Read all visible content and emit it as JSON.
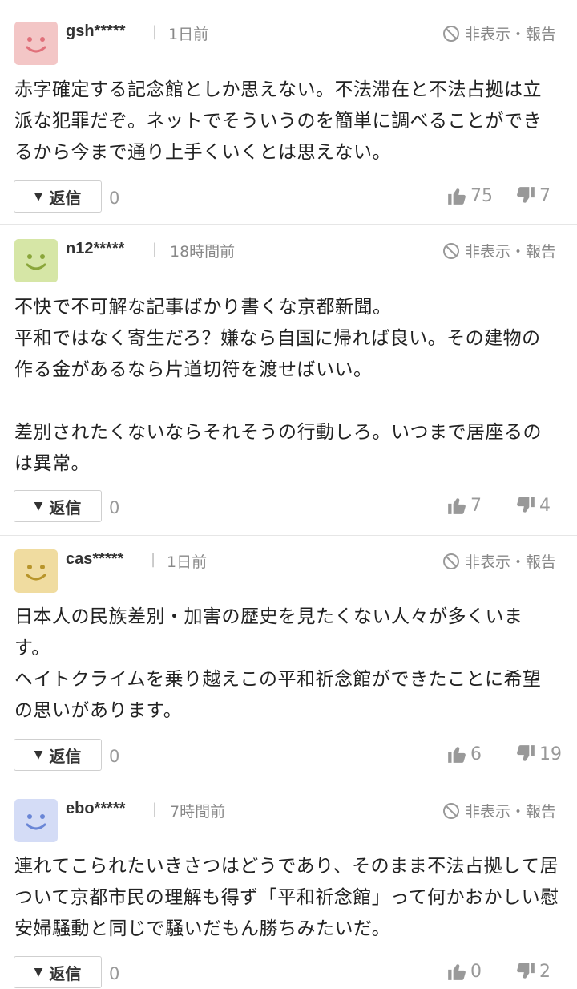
{
  "ui": {
    "hide_report": "非表示・報告",
    "reply": "返信",
    "divider": "|"
  },
  "comments": [
    {
      "user": "gsh*****",
      "time": "1日前",
      "avatar_bg": "#f3c6c6",
      "avatar_fg": "#e0707a",
      "avatar_icon": "smile-face-icon",
      "text": "赤字確定する記念館としか思えない。不法滞在と不法占拠は立派な犯罪だぞ。ネットでそういうのを簡単に調べることができるから今まで通り上手くいくとは思えない。",
      "replies": "0",
      "likes": "75",
      "dislikes": "7"
    },
    {
      "user": "n12*****",
      "time": "18時間前",
      "avatar_bg": "#d6e6a6",
      "avatar_fg": "#8aa63a",
      "avatar_icon": "smile-face-icon",
      "text": "不快で不可解な記事ばかり書くな京都新聞。\n平和ではなく寄生だろ？嫌なら自国に帰れば良い。その建物の作る金があるなら片道切符を渡せばいい。\n\n差別されたくないならそれそうの行動しろ。いつまで居座るのは異常。",
      "replies": "0",
      "likes": "7",
      "dislikes": "4"
    },
    {
      "user": "cas*****",
      "time": "1日前",
      "avatar_bg": "#f0dca0",
      "avatar_fg": "#b8952a",
      "avatar_icon": "smile-face-icon",
      "text": "日本人の民族差別・加害の歴史を見たくない人々が多くいます。\nヘイトクライムを乗り越えこの平和祈念館ができたことに希望の思いがあります。",
      "replies": "0",
      "likes": "6",
      "dislikes": "19"
    },
    {
      "user": "ebo*****",
      "time": "7時間前",
      "avatar_bg": "#d4dcf6",
      "avatar_fg": "#6a86d6",
      "avatar_icon": "smile-face-icon",
      "text": "連れてこられたいきさつはどうであり、そのまま不法占拠して居ついて京都市民の理解も得ず「平和祈念館」って何かおかしい慰安婦騒動と同じで騒いだもん勝ちみたいだ。",
      "replies": "0",
      "likes": "0",
      "dislikes": "2"
    }
  ]
}
